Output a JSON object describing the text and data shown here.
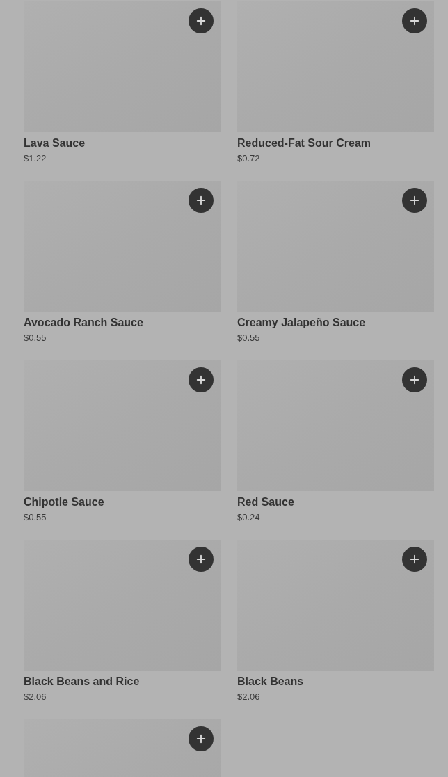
{
  "items": [
    {
      "kind": "card",
      "name": "Lava Sauce",
      "price": "$1.22"
    },
    {
      "kind": "card",
      "name": "Reduced-Fat Sour Cream",
      "price": "$0.72"
    },
    {
      "kind": "card",
      "name": "Avocado Ranch Sauce",
      "price": "$0.55"
    },
    {
      "kind": "card",
      "name": "Creamy Jalapeño Sauce",
      "price": "$0.55"
    },
    {
      "kind": "card",
      "name": "Chipotle Sauce",
      "price": "$0.55"
    },
    {
      "kind": "card",
      "name": "Red Sauce",
      "price": "$0.24"
    },
    {
      "kind": "card",
      "name": "Black Beans and Rice",
      "price": "$2.06"
    },
    {
      "kind": "card",
      "name": "Black Beans",
      "price": "$2.06"
    },
    {
      "kind": "cut_off"
    }
  ]
}
